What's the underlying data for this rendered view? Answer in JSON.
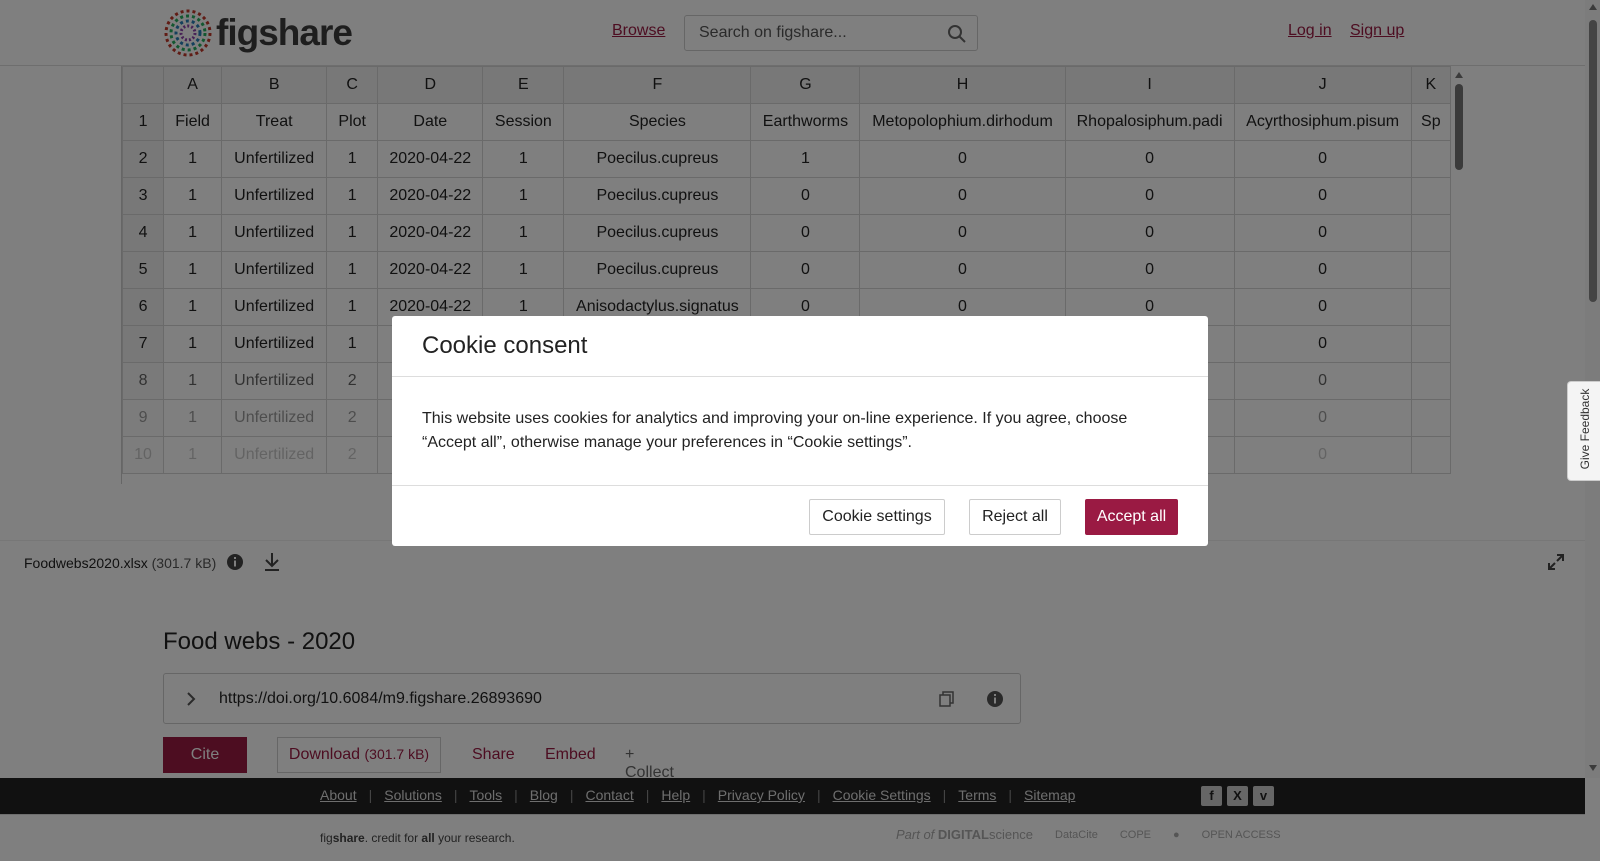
{
  "header": {
    "brand": "figshare",
    "browse_label": "Browse",
    "search_placeholder": "Search on figshare...",
    "login_label": "Log in",
    "signup_label": "Sign up"
  },
  "sheet": {
    "col_letters": [
      "A",
      "B",
      "C",
      "D",
      "E",
      "F",
      "G",
      "H",
      "I",
      "J",
      "K"
    ],
    "header_row": [
      "Field",
      "Treat",
      "Plot",
      "Date",
      "Session",
      "Species",
      "Earthworms",
      "Metopolophium.dirhodum",
      "Rhopalosiphum.padi",
      "Acyrthosiphum.pisum",
      "Sp"
    ],
    "rows": [
      [
        "1",
        "Unfertilized",
        "1",
        "2020-04-22",
        "1",
        "Poecilus.cupreus",
        "1",
        "0",
        "0",
        "0",
        ""
      ],
      [
        "1",
        "Unfertilized",
        "1",
        "2020-04-22",
        "1",
        "Poecilus.cupreus",
        "0",
        "0",
        "0",
        "0",
        ""
      ],
      [
        "1",
        "Unfertilized",
        "1",
        "2020-04-22",
        "1",
        "Poecilus.cupreus",
        "0",
        "0",
        "0",
        "0",
        ""
      ],
      [
        "1",
        "Unfertilized",
        "1",
        "2020-04-22",
        "1",
        "Poecilus.cupreus",
        "0",
        "0",
        "0",
        "0",
        ""
      ],
      [
        "1",
        "Unfertilized",
        "1",
        "2020-04-22",
        "1",
        "Anisodactylus.signatus",
        "0",
        "0",
        "0",
        "0",
        ""
      ],
      [
        "1",
        "Unfertilized",
        "1",
        "",
        "",
        "",
        "",
        "",
        "",
        "0",
        ""
      ],
      [
        "1",
        "Unfertilized",
        "2",
        "",
        "",
        "",
        "",
        "",
        "",
        "0",
        ""
      ],
      [
        "1",
        "Unfertilized",
        "2",
        "",
        "",
        "",
        "",
        "",
        "",
        "0",
        ""
      ],
      [
        "1",
        "Unfertilized",
        "2",
        "",
        "",
        "",
        "",
        "",
        "",
        "0",
        ""
      ]
    ]
  },
  "file": {
    "name": "Foodwebs2020.xlsx",
    "size": "(301.7 kB)"
  },
  "item": {
    "title": "Food webs - 2020",
    "doi": "https://doi.org/10.6084/m9.figshare.26893690",
    "cite_label": "Cite",
    "download_label": "Download",
    "download_size": "(301.7 kB)",
    "share_label": "Share",
    "embed_label": "Embed",
    "collect_label": "+ Collect"
  },
  "footer": {
    "links": [
      "About",
      "Solutions",
      "Tools",
      "Blog",
      "Contact",
      "Help",
      "Privacy Policy",
      "Cookie Settings",
      "Terms",
      "Sitemap"
    ],
    "tagline_parts": [
      "fig",
      "share",
      ". credit for ",
      "all",
      " your research."
    ],
    "partner_part_of": "Part of",
    "partner_digital": "DIGITAL",
    "partner_science": "science",
    "partner_datacite": "DataCite",
    "partner_cope": "COPE",
    "partner_openaccess": "OPEN ACCESS"
  },
  "feedback_label": "Give Feedback",
  "cookie": {
    "title": "Cookie consent",
    "body": "This website uses cookies for analytics and improving your on-line experience. If you agree, choose “Accept all”, otherwise manage your preferences in “Cookie settings”.",
    "settings_label": "Cookie settings",
    "reject_label": "Reject all",
    "accept_label": "Accept all"
  },
  "colors": {
    "brand": "#9a1a43",
    "overlay": "rgba(0,0,0,0.5)"
  }
}
